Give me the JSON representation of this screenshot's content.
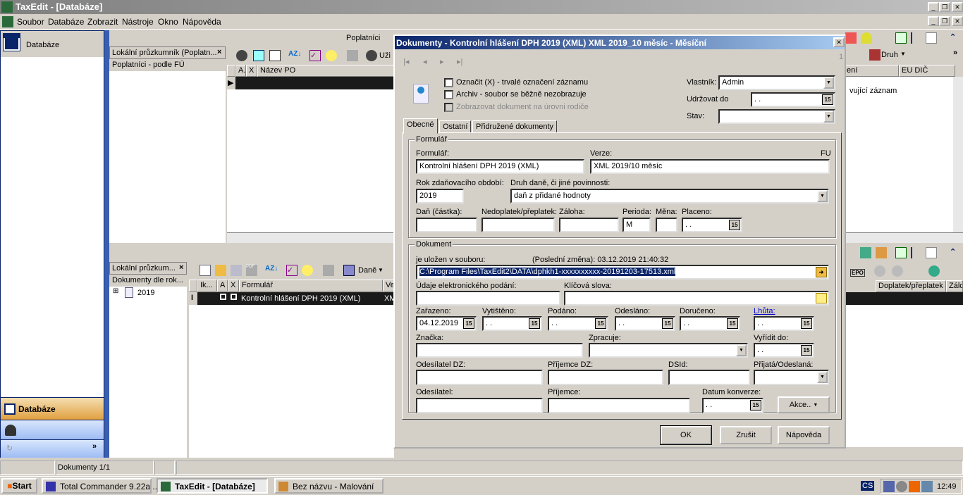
{
  "app": {
    "title": "TaxEdit - [Databáze]"
  },
  "menu": [
    "Soubor",
    "Databáze",
    "Zobrazit",
    "Nástroje",
    "Okno",
    "Nápověda"
  ],
  "sidebar": {
    "header": "Databáze",
    "nav_active": "Databáze"
  },
  "top_pane": {
    "title": "Poplatníci",
    "explorer_tab": "Lokální průzkumník (Poplatn...",
    "explorer_item": "Poplatníci - podle FÚ",
    "toolbar_user": "Uži",
    "toolbar_druh": "Druh",
    "columns": [
      "A.",
      "X",
      "Název PO"
    ],
    "right_columns": [
      "ení",
      "EU DIČ"
    ],
    "right_text": "vující záznam"
  },
  "bottom_pane": {
    "explorer_tab": "Lokální průzkum...",
    "explorer_item": "Dokumenty dle rok...",
    "tree_node": "2019",
    "toolbar_dane": "Daně",
    "columns": [
      "Ik...",
      "A",
      "X",
      "Formulář",
      "Ve"
    ],
    "right_columns": [
      "Doplatek/přeplatek",
      "Zálo"
    ],
    "row": {
      "formular": "Kontrolní hlášení DPH 2019 (XML)",
      "verze": "XM"
    },
    "epo": "EPO"
  },
  "dialog": {
    "title": "Dokumenty - Kontrolní hlášení DPH 2019 (XML) XML 2019_10 měsíc - Měsíční",
    "record_index": "1",
    "checks": {
      "oznacit": "Označit (X) - trvalé označení záznamu",
      "archiv": "Archiv - soubor se běžně nezobrazuje",
      "zobrazovat": "Zobrazovat dokument na úrovni rodiče"
    },
    "vlastnik_label": "Vlastník:",
    "vlastnik": "Admin",
    "udrzovat_label": "Udržovat do",
    "udrzovat": ". .",
    "stav_label": "Stav:",
    "stav": "",
    "tabs": [
      "Obecné",
      "Ostatní",
      "Přidružené dokumenty"
    ],
    "formular_group": {
      "title": "Formulář",
      "formular_label": "Formulář:",
      "formular": "Kontrolní hlášení DPH 2019 (XML)",
      "verze_label": "Verze:",
      "verze": "XML 2019/10 měsíc",
      "fu_label": "FU",
      "rok_label": "Rok zdaňovacího období:",
      "rok": "2019",
      "druh_label": "Druh daně, či jiné povinnosti:",
      "druh": "daň z přidané hodnoty",
      "dan_label": "Daň (částka):",
      "nedoplatek_label": "Nedoplatek/přeplatek:",
      "zaloha_label": "Záloha:",
      "perioda_label": "Perioda:",
      "perioda": "M",
      "mena_label": "Měna:",
      "placeno_label": "Placeno:",
      "placeno": ". ."
    },
    "dokument_group": {
      "title": "Dokument",
      "ulozen_label": "je uložen v souboru:",
      "posledni_zmena": "(Poslední změna): 03.12.2019 21:40:32",
      "path": "C:\\Program Files\\TaxEdit2\\DATA\\dphkh1-xxxxxxxxxx-20191203-17513.xml",
      "udaje_label": "Údaje elektronického podání:",
      "klicova_label": "Klíčová slova:",
      "zarazeno_label": "Zařazeno:",
      "zarazeno": "04.12.2019",
      "vytisteno_label": "Vytištěno:",
      "podano_label": "Podáno:",
      "odeslano_label": "Odesláno:",
      "doruceno_label": "Doručeno:",
      "lhuta_label": "Lhůta:",
      "empty_date": ". .",
      "znacka_label": "Značka:",
      "zpracuje_label": "Zpracuje:",
      "vyridit_label": "Vyřídit do:",
      "odesilatel_dz_label": "Odesílatel DZ:",
      "prijemce_dz_label": "Příjemce DZ:",
      "dsid_label": "DSId:",
      "prijata_label": "Přijatá/Odeslaná:",
      "odesilatel_label": "Odesílatel:",
      "prijemce_label": "Příjemce:",
      "konverze_label": "Datum konverze:",
      "akce": "Akce.."
    },
    "buttons": {
      "ok": "OK",
      "cancel": "Zrušit",
      "help": "Nápověda"
    },
    "calendar_glyph": "15"
  },
  "statusbar": {
    "docs": "Dokumenty 1/1"
  },
  "taskbar": {
    "start": "Start",
    "items": [
      "Total Commander 9.22a ...",
      "TaxEdit - [Databáze]",
      "Bez názvu - Malování"
    ],
    "lang": "CS",
    "clock": "12:49"
  }
}
